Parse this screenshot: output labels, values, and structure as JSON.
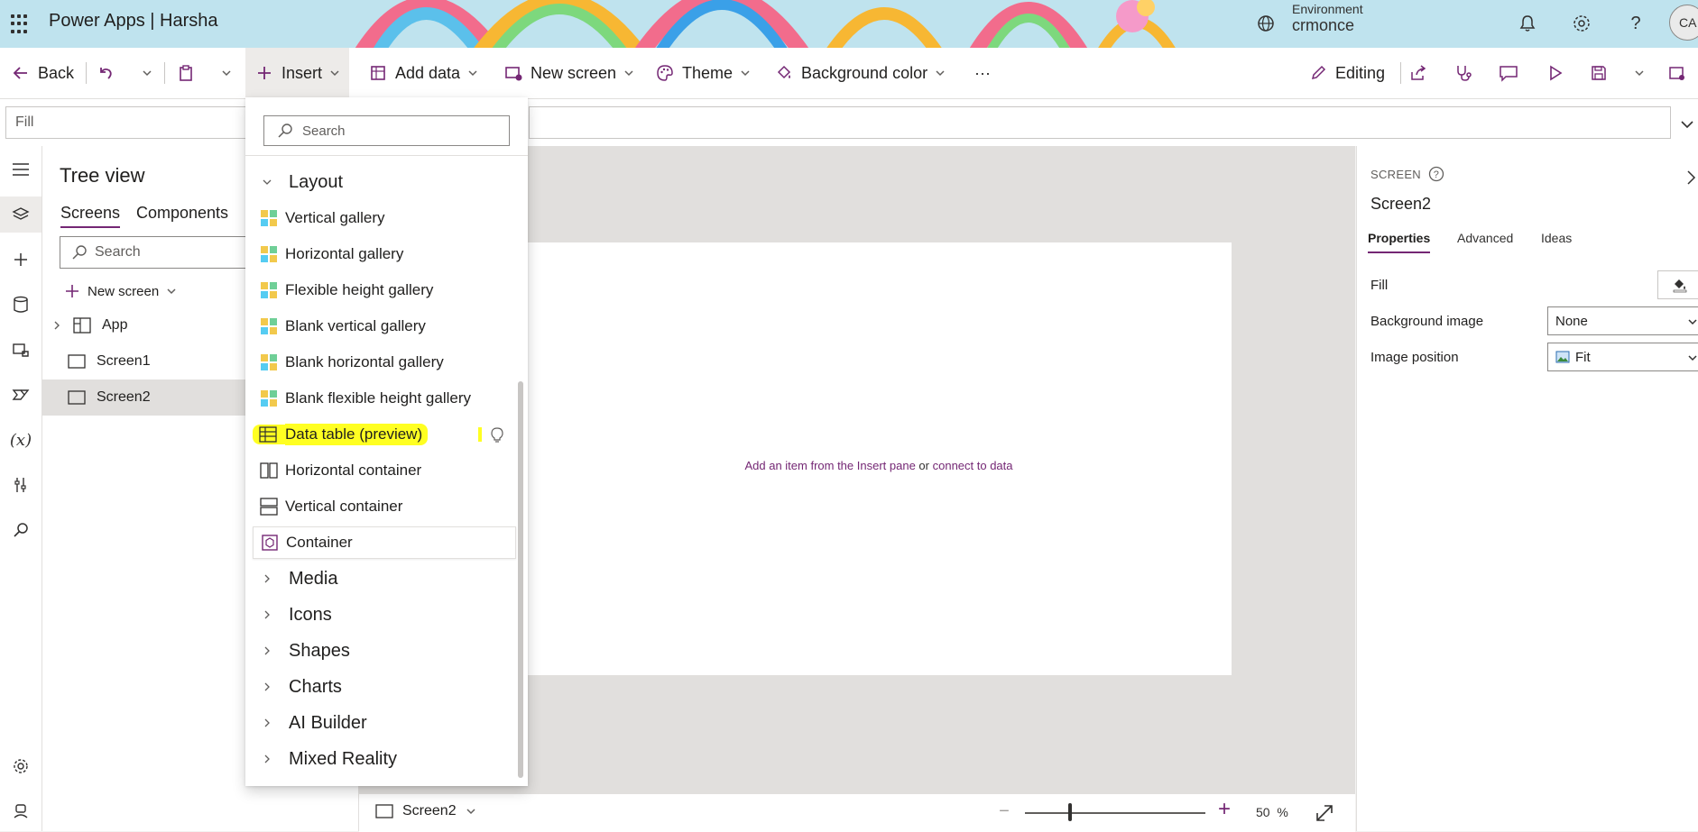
{
  "header": {
    "app_title": "Power Apps  |  Harsha",
    "environment_label": "Environment",
    "environment_value": "crmonce",
    "avatar_initials": "CA"
  },
  "toolbar": {
    "back_label": "Back",
    "insert_label": "Insert",
    "add_data_label": "Add data",
    "new_screen_label": "New screen",
    "theme_label": "Theme",
    "background_color_label": "Background color",
    "more_label": "···",
    "editing_label": "Editing"
  },
  "formula_bar": {
    "property": "Fill"
  },
  "tree_view": {
    "title": "Tree view",
    "tabs": [
      "Screens",
      "Components"
    ],
    "search_placeholder": "Search",
    "new_screen_label": "New screen",
    "items": [
      {
        "label": "App"
      },
      {
        "label": "Screen1"
      },
      {
        "label": "Screen2"
      }
    ]
  },
  "insert_menu": {
    "search_placeholder": "Search",
    "layout_category": "Layout",
    "layout_items": [
      "Vertical gallery",
      "Horizontal gallery",
      "Flexible height gallery",
      "Blank vertical gallery",
      "Blank horizontal gallery",
      "Blank flexible height gallery",
      "Data table (preview)",
      "Horizontal container",
      "Vertical container",
      "Container"
    ],
    "other_categories": [
      "Media",
      "Icons",
      "Shapes",
      "Charts",
      "AI Builder",
      "Mixed Reality"
    ]
  },
  "canvas": {
    "hint_part1": "Add an item from the Insert pane",
    "hint_or": "or",
    "hint_link": "connect to data"
  },
  "status_bar": {
    "screen_name": "Screen2",
    "zoom_value": "50",
    "zoom_unit": "%"
  },
  "properties_panel": {
    "kind_label": "SCREEN",
    "screen_name": "Screen2",
    "tabs": [
      "Properties",
      "Advanced",
      "Ideas"
    ],
    "fill_label": "Fill",
    "background_image_label": "Background image",
    "background_image_value": "None",
    "image_position_label": "Image position",
    "image_position_value": "Fit"
  },
  "colors": {
    "accent": "#742774",
    "highlight": "#ffff22",
    "header_bg": "#bfe3ee"
  }
}
